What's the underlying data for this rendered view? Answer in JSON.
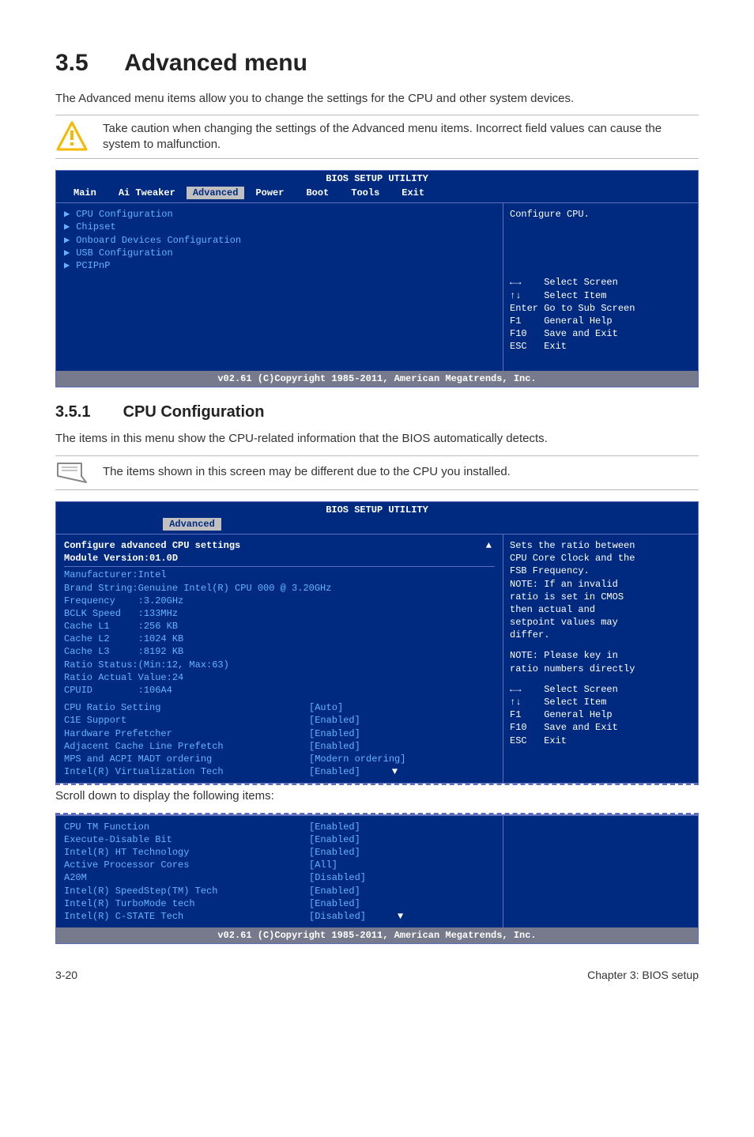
{
  "section": {
    "number": "3.5",
    "title": "Advanced menu",
    "intro": "The Advanced menu items allow you to change the settings for the CPU and other system devices.",
    "caution": "Take caution when changing the settings of the Advanced menu items. Incorrect field values can cause the system to malfunction."
  },
  "bios1": {
    "title": "BIOS SETUP UTILITY",
    "menubar": [
      "Main",
      "Ai Tweaker",
      "Advanced",
      "Power",
      "Boot",
      "Tools",
      "Exit"
    ],
    "active": "Advanced",
    "items": [
      "CPU Configuration",
      "Chipset",
      "Onboard Devices Configuration",
      "USB Configuration",
      "PCIPnP"
    ],
    "help": "Configure CPU.",
    "nav": [
      "←→    Select Screen",
      "↑↓    Select Item",
      "Enter Go to Sub Screen",
      "F1    General Help",
      "F10   Save and Exit",
      "ESC   Exit"
    ],
    "footer": "v02.61 (C)Copyright 1985-2011, American Megatrends, Inc."
  },
  "sub": {
    "number": "3.5.1",
    "title": "CPU Configuration",
    "intro": "The items in this menu show the CPU-related information that the BIOS automatically detects.",
    "note": "The items shown in this screen may be different due to the CPU you installed."
  },
  "bios2": {
    "title": "BIOS SETUP UTILITY",
    "active": "Advanced",
    "hdr1": "Configure advanced CPU settings",
    "hdr2": "Module Version:01.0D",
    "info": [
      "Manufacturer:Intel",
      "Brand String:Genuine Intel(R) CPU 000 @ 3.20GHz",
      "Frequency    :3.20GHz",
      "BCLK Speed   :133MHz",
      "Cache L1     :256 KB",
      "Cache L2     :1024 KB",
      "Cache L3     :8192 KB",
      "Ratio Status:(Min:12, Max:63)",
      "Ratio Actual Value:24",
      "CPUID        :106A4"
    ],
    "settings": [
      {
        "k": "CPU Ratio Setting",
        "v": "[Auto]"
      },
      {
        "k": "C1E Support",
        "v": "[Enabled]"
      },
      {
        "k": "Hardware Prefetcher",
        "v": "[Enabled]"
      },
      {
        "k": "Adjacent Cache Line Prefetch",
        "v": "[Enabled]"
      },
      {
        "k": "MPS and ACPI MADT ordering",
        "v": "[Modern ordering]"
      },
      {
        "k": "Intel(R) Virtualization Tech",
        "v": "[Enabled]"
      }
    ],
    "help": [
      "Sets the ratio between",
      "CPU Core Clock and the",
      "FSB Frequency.",
      "NOTE: If an invalid",
      "ratio is set in CMOS",
      "then actual and",
      "setpoint values may",
      "differ.",
      "",
      "NOTE: Please key in",
      "ratio numbers directly"
    ],
    "nav": [
      "←→    Select Screen",
      "↑↓    Select Item",
      "F1    General Help",
      "F10   Save and Exit",
      "ESC   Exit"
    ]
  },
  "scroll_caption": "Scroll down to display the following items:",
  "bios3": {
    "settings": [
      {
        "k": "CPU TM Function",
        "v": "[Enabled]"
      },
      {
        "k": "Execute-Disable Bit",
        "v": "[Enabled]"
      },
      {
        "k": "Intel(R) HT Technology",
        "v": "[Enabled]"
      },
      {
        "k": "Active Processor Cores",
        "v": "[All]"
      },
      {
        "k": "A20M",
        "v": "[Disabled]"
      },
      {
        "k": "Intel(R) SpeedStep(TM) Tech",
        "v": "[Enabled]"
      },
      {
        "k": "Intel(R) TurboMode tech",
        "v": "[Enabled]"
      },
      {
        "k": "Intel(R) C-STATE Tech",
        "v": "[Disabled]"
      }
    ],
    "footer": "v02.61 (C)Copyright 1985-2011, American Megatrends, Inc."
  },
  "page_footer": {
    "left": "3-20",
    "right": "Chapter 3: BIOS setup"
  }
}
